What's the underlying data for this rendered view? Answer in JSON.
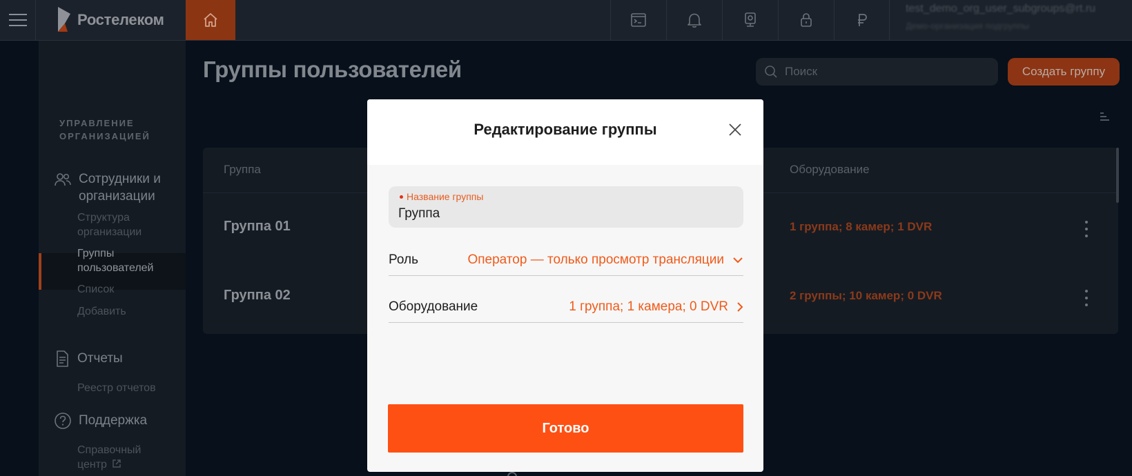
{
  "header": {
    "logo_text": "Ростелеком",
    "user_email": "test_demo_org_user_subgroups@rt.ru",
    "user_subtitle": "Демо-организация подгруппы",
    "icons": [
      "menu-icon",
      "home-icon",
      "terminal-icon",
      "bell-icon",
      "camera-icon",
      "lock-icon",
      "ruble-icon"
    ]
  },
  "sidebar": {
    "section_title": "УПРАВЛЕНИЕ ОРГАНИЗАЦИЕЙ",
    "employees": {
      "label": "Сотрудники и организации",
      "items": [
        "Структура организации",
        "Группы пользователей",
        "Список",
        "Добавить"
      ]
    },
    "reports": {
      "label": "Отчеты",
      "items": [
        "Реестр отчетов"
      ]
    },
    "support": {
      "label": "Поддержка",
      "items": [
        "Справочный центр"
      ]
    }
  },
  "main": {
    "page_title": "Группы пользователей",
    "search_placeholder": "Поиск",
    "create_button": "Создать группу",
    "table": {
      "columns": [
        "Группа",
        "Оборудование"
      ],
      "rows": [
        {
          "name": "Группа 01",
          "equipment": "1 группа; 8 камер; 1 DVR"
        },
        {
          "name": "Группа 02",
          "equipment": "2 группы; 10 камер; 0 DVR"
        }
      ]
    }
  },
  "modal": {
    "title": "Редактирование группы",
    "name_field": {
      "label": "Название группы",
      "value": "Группа"
    },
    "role": {
      "label": "Роль",
      "value": "Оператор — только просмотр трансляции"
    },
    "equipment": {
      "label": "Оборудование",
      "value": "1 группа; 1 камера; 0 DVR"
    },
    "done_button": "Готово"
  },
  "colors": {
    "accent": "#ff5014",
    "accent_text": "#f05a1a",
    "dimmed_accent": "#8c3413",
    "background": "#07101b",
    "panel": "#151b23"
  }
}
